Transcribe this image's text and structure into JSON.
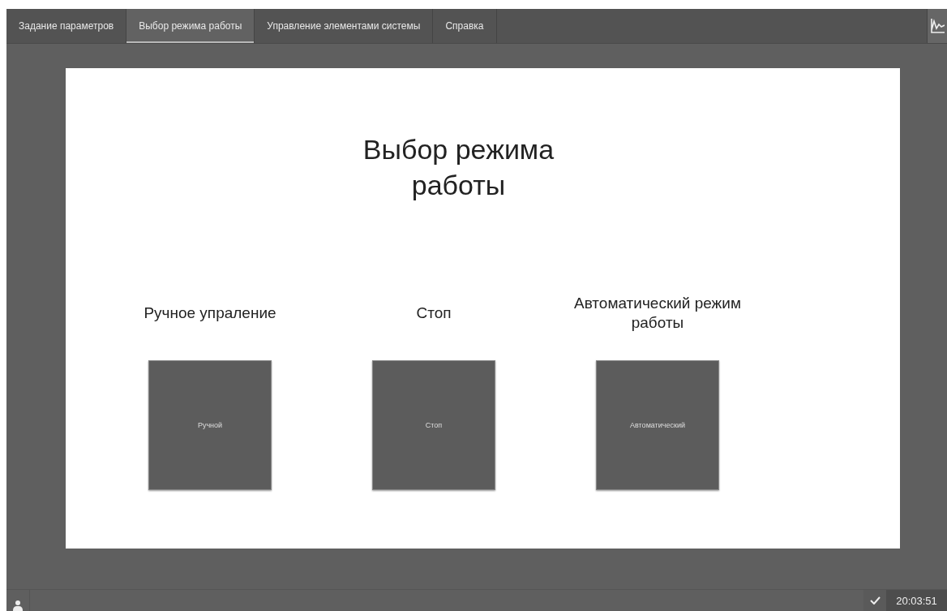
{
  "tabs": [
    {
      "label": "Задание параметров",
      "selected": false
    },
    {
      "label": "Выбор режима работы",
      "selected": true
    },
    {
      "label": "Управление элементами системы",
      "selected": false
    },
    {
      "label": "Справка",
      "selected": false
    }
  ],
  "page": {
    "title": "Выбор режима\nработы",
    "modes": [
      {
        "label": "Ручное упраление",
        "button": "Ручной"
      },
      {
        "label": "Стоп",
        "button": "Стоп"
      },
      {
        "label": "Автоматический режим\nработы",
        "button": "Автоматический"
      }
    ]
  },
  "status_bar": {
    "time": "20:03:51"
  }
}
